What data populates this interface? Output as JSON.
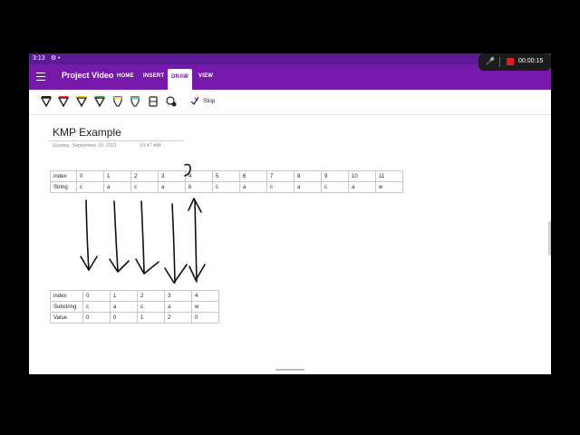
{
  "status": {
    "time": "3:13"
  },
  "app": {
    "title": "Project Video",
    "tabs": [
      "HOME",
      "INSERT",
      "DRAW",
      "VIEW"
    ],
    "active_tab": "DRAW"
  },
  "recorder": {
    "timer": "00:00:15"
  },
  "ribbon": {
    "tools": [
      {
        "name": "pen-black",
        "color": "#222222"
      },
      {
        "name": "pen-red",
        "color": "#e53935"
      },
      {
        "name": "pen-yellow",
        "color": "#fbc02d"
      },
      {
        "name": "pen-green",
        "color": "#4caf50"
      },
      {
        "name": "highlighter-yellow",
        "color": "#f9e24b"
      },
      {
        "name": "highlighter-teal",
        "color": "#4dd0c6"
      }
    ],
    "stop_label": "Stop"
  },
  "page": {
    "title": "KMP Example",
    "date": "Sunday, September 19, 2021",
    "time": "10:47 AM"
  },
  "table1": {
    "rows": [
      [
        "index",
        "0",
        "1",
        "2",
        "3",
        "4",
        "5",
        "6",
        "7",
        "8",
        "9",
        "10",
        "11"
      ],
      [
        "String",
        "c",
        "a",
        "c",
        "a",
        "b",
        "c",
        "a",
        "c",
        "a",
        "c",
        "a",
        "w"
      ]
    ]
  },
  "table2": {
    "rows": [
      [
        "index",
        "0",
        "1",
        "2",
        "3",
        "4"
      ],
      [
        "Substring",
        "c",
        "a",
        "c",
        "a",
        "w"
      ],
      [
        "Value",
        "0",
        "0",
        "1",
        "2",
        "0"
      ]
    ]
  }
}
